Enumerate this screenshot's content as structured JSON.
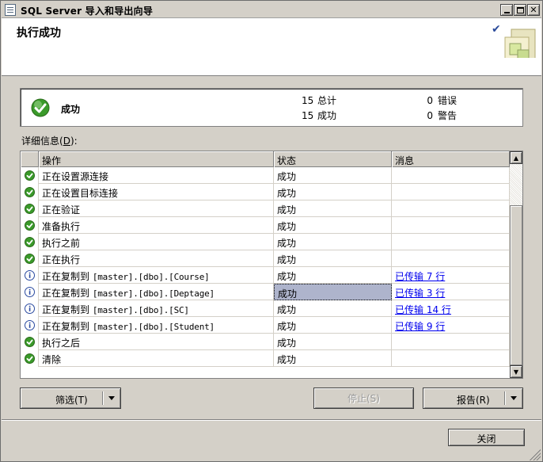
{
  "window": {
    "title": "SQL Server 导入和导出向导"
  },
  "header": {
    "title": "执行成功"
  },
  "summary": {
    "status": "成功",
    "total_count": "15",
    "total_label": "总计",
    "success_count": "15",
    "success_label": "成功",
    "error_count": "0",
    "error_label": "错误",
    "warning_count": "0",
    "warning_label": "警告"
  },
  "details": {
    "label": "详细信息",
    "hotkey": "D",
    "label_suffix": "):"
  },
  "grid": {
    "columns": [
      "操作",
      "状态",
      "消息"
    ],
    "rows": [
      {
        "icon": "success-icon",
        "action": "正在设置源连接",
        "status": "成功",
        "message": ""
      },
      {
        "icon": "success-icon",
        "action": "正在设置目标连接",
        "status": "成功",
        "message": ""
      },
      {
        "icon": "success-icon",
        "action": "正在验证",
        "status": "成功",
        "message": ""
      },
      {
        "icon": "success-icon",
        "action": "准备执行",
        "status": "成功",
        "message": ""
      },
      {
        "icon": "success-icon",
        "action": "执行之前",
        "status": "成功",
        "message": ""
      },
      {
        "icon": "success-icon",
        "action": "正在执行",
        "status": "成功",
        "message": ""
      },
      {
        "icon": "info-icon",
        "action": "正在复制到 [master].[dbo].[Course]",
        "status": "成功",
        "message": "已传输 7 行"
      },
      {
        "icon": "info-icon",
        "action": "正在复制到 [master].[dbo].[Deptage]",
        "status": "成功",
        "message": "已传输 3 行"
      },
      {
        "icon": "info-icon",
        "action": "正在复制到 [master].[dbo].[SC]",
        "status": "成功",
        "message": "已传输 14 行"
      },
      {
        "icon": "info-icon",
        "action": "正在复制到 [master].[dbo].[Student]",
        "status": "成功",
        "message": "已传输 9 行"
      },
      {
        "icon": "success-icon",
        "action": "执行之后",
        "status": "成功",
        "message": ""
      },
      {
        "icon": "success-icon",
        "action": "清除",
        "status": "成功",
        "message": ""
      }
    ],
    "selected_row_index": 7
  },
  "buttons": {
    "filter": "筛选(T)",
    "stop": "停止(S)",
    "report": "报告(R)",
    "close": "关闭"
  },
  "colors": {
    "success_green": "#3a9a2a",
    "info_blue": "#2a4aa0",
    "selection": "#aeb4cc",
    "link": "#0000ee"
  }
}
